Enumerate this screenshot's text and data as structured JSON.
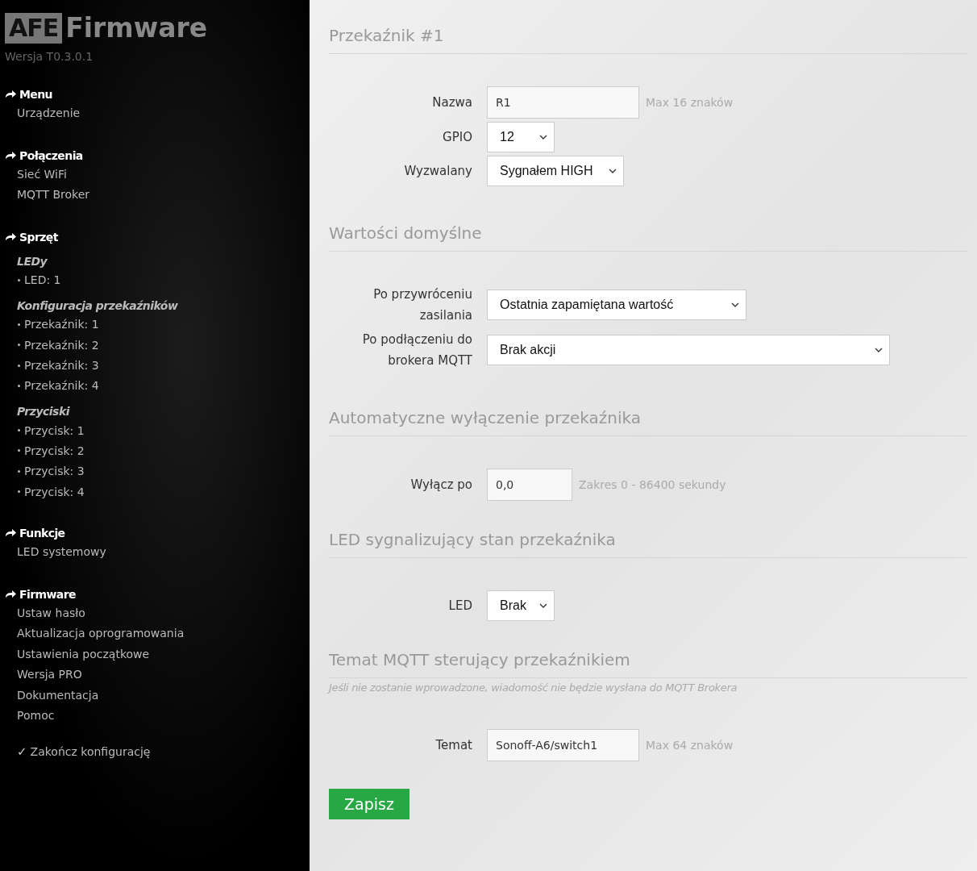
{
  "logo": {
    "badge": "AFE",
    "title": "Firmware"
  },
  "version": "Wersja T0.3.0.1",
  "sidebar": {
    "sections": [
      {
        "title": "Menu",
        "items": [
          {
            "kind": "link",
            "label": "Urządzenie"
          }
        ]
      },
      {
        "title": "Połączenia",
        "items": [
          {
            "kind": "link",
            "label": "Sieć WiFi"
          },
          {
            "kind": "link",
            "label": "MQTT Broker"
          }
        ]
      },
      {
        "title": "Sprzęt",
        "items": [
          {
            "kind": "subheading",
            "label": "LEDy"
          },
          {
            "kind": "bullet",
            "label": "LED: 1"
          },
          {
            "kind": "subheading",
            "label": "Konfiguracja przekaźników"
          },
          {
            "kind": "bullet",
            "label": "Przekaźnik: 1"
          },
          {
            "kind": "bullet",
            "label": "Przekaźnik: 2"
          },
          {
            "kind": "bullet",
            "label": "Przekaźnik: 3"
          },
          {
            "kind": "bullet",
            "label": "Przekaźnik: 4"
          },
          {
            "kind": "subheading",
            "label": "Przyciski"
          },
          {
            "kind": "bullet",
            "label": "Przycisk: 1"
          },
          {
            "kind": "bullet",
            "label": "Przycisk: 2"
          },
          {
            "kind": "bullet",
            "label": "Przycisk: 3"
          },
          {
            "kind": "bullet",
            "label": "Przycisk: 4"
          }
        ]
      },
      {
        "title": "Funkcje",
        "items": [
          {
            "kind": "link",
            "label": "LED systemowy"
          }
        ]
      },
      {
        "title": "Firmware",
        "items": [
          {
            "kind": "link",
            "label": "Ustaw hasło"
          },
          {
            "kind": "link",
            "label": "Aktualizacja oprogramowania"
          },
          {
            "kind": "link",
            "label": "Ustawienia początkowe"
          },
          {
            "kind": "link",
            "label": "Wersja PRO"
          },
          {
            "kind": "link",
            "label": "Dokumentacja"
          },
          {
            "kind": "link",
            "label": "Pomoc"
          }
        ]
      }
    ],
    "finish": {
      "icon": "✓",
      "label": "Zakończ konfigurację"
    }
  },
  "form": {
    "sections": [
      {
        "title": "Przekaźnik #1",
        "fields": [
          {
            "kind": "input",
            "label": "Nazwa",
            "value": "R1",
            "hint": "Max 16 znaków"
          },
          {
            "kind": "select",
            "label": "GPIO",
            "value": "12"
          },
          {
            "kind": "select",
            "label": "Wyzwalany",
            "value": "Sygnałem HIGH"
          }
        ]
      },
      {
        "title": "Wartości domyślne",
        "fields": [
          {
            "kind": "select",
            "label": "Po przywróceniu zasilania",
            "value": "Ostatnia zapamiętana wartość"
          },
          {
            "kind": "select",
            "label": "Po podłączeniu do brokera MQTT",
            "value": "Brak akcji"
          }
        ]
      },
      {
        "title": "Automatyczne wyłączenie przekaźnika",
        "fields": [
          {
            "kind": "input",
            "label": "Wyłącz po",
            "value": "0,0",
            "hint": "Zakres 0 - 86400 sekundy"
          }
        ]
      },
      {
        "title": "LED sygnalizujący stan przekaźnika",
        "fields": [
          {
            "kind": "select",
            "label": "LED",
            "value": "Brak"
          }
        ]
      },
      {
        "title": "Temat MQTT sterujący przekaźnikiem",
        "note": "Jeśli nie zostanie wprowadzone, wiadomość nie będzie wysłana do MQTT Brokera",
        "fields": [
          {
            "kind": "input",
            "label": "Temat",
            "value": "Sonoff-A6/switch1",
            "hint": "Max 64 znaków"
          }
        ]
      }
    ],
    "save": "Zapisz"
  }
}
